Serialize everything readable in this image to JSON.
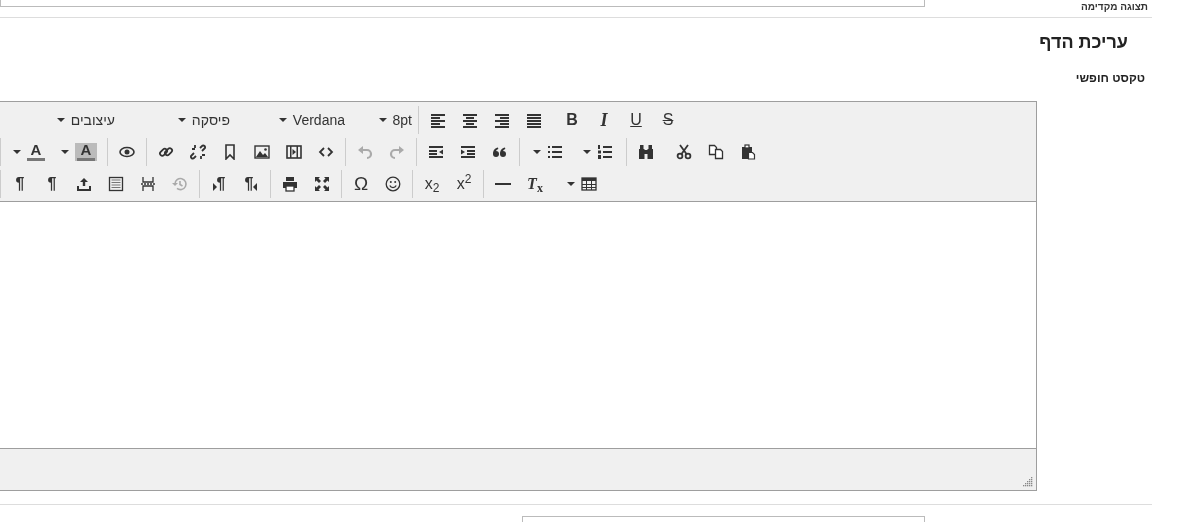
{
  "top_row": {
    "label": "תצוגה מקדימה"
  },
  "section": {
    "title": "עריכת הדף",
    "field_label": "טקסט חופשי"
  },
  "editor": {
    "toolbar": [
      [
        [
          {
            "kind": "strike",
            "label": "S"
          },
          {
            "kind": "underline",
            "label": "U"
          },
          {
            "kind": "italic",
            "label": "I"
          },
          {
            "kind": "bold",
            "label": "B"
          }
        ],
        [
          {
            "kind": "justify"
          },
          {
            "kind": "align-right"
          },
          {
            "kind": "align-center"
          },
          {
            "kind": "align-left"
          }
        ],
        [
          {
            "kind": "dropdown",
            "label": "8pt"
          },
          {
            "kind": "dropdown",
            "label": "Verdana"
          },
          {
            "kind": "dropdown",
            "label": "פיסקה"
          },
          {
            "kind": "dropdown",
            "label": "עיצובים"
          }
        ]
      ],
      [
        [
          {
            "kind": "paste"
          },
          {
            "kind": "copy"
          },
          {
            "kind": "cut"
          }
        ],
        [
          {
            "kind": "find"
          }
        ],
        [
          {
            "kind": "numbered-list"
          },
          {
            "kind": "bullet-list"
          }
        ],
        [
          {
            "kind": "blockquote"
          },
          {
            "kind": "indent"
          },
          {
            "kind": "outdent"
          }
        ],
        [
          {
            "kind": "redo",
            "disabled": true
          },
          {
            "kind": "undo",
            "disabled": true
          }
        ],
        [
          {
            "kind": "source"
          },
          {
            "kind": "media"
          },
          {
            "kind": "image"
          },
          {
            "kind": "anchor"
          },
          {
            "kind": "unlink"
          },
          {
            "kind": "link"
          }
        ],
        [
          {
            "kind": "preview"
          }
        ],
        [
          {
            "kind": "background-color",
            "label": "A"
          },
          {
            "kind": "text-color",
            "label": "A"
          }
        ]
      ],
      [
        [
          {
            "kind": "table"
          }
        ],
        [
          {
            "kind": "remove-format",
            "label": "*T*$_{x}$"
          },
          {
            "kind": "horizontal-line"
          }
        ],
        [
          {
            "kind": "superscript",
            "label": "x$^{2}$"
          },
          {
            "kind": "subscript",
            "label": "x$_{2}$"
          }
        ],
        [
          {
            "kind": "emoji"
          },
          {
            "kind": "special-char",
            "label": "Ω"
          }
        ],
        [
          {
            "kind": "maximize"
          },
          {
            "kind": "print"
          }
        ],
        [
          {
            "kind": "rtl",
            "label": "¶"
          },
          {
            "kind": "ltr",
            "label": "¶"
          }
        ],
        [
          {
            "kind": "restore",
            "disabled": true
          },
          {
            "kind": "page-break"
          },
          {
            "kind": "iframe"
          },
          {
            "kind": "upload"
          },
          {
            "kind": "paragraph",
            "label": "¶"
          },
          {
            "kind": "paragraph",
            "label": "¶"
          }
        ]
      ]
    ]
  }
}
